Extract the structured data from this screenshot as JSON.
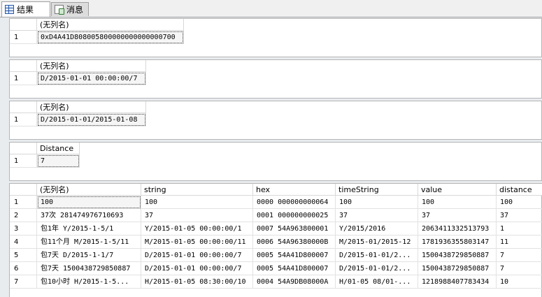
{
  "tabs": [
    {
      "label": "结果",
      "icon": "results-grid-icon",
      "active": true
    },
    {
      "label": "消息",
      "icon": "messages-icon",
      "active": false
    }
  ],
  "grids": [
    {
      "columns": [
        "(无列名)"
      ],
      "rows": [
        [
          "1",
          "0xD4A41D808005800000000000000700"
        ]
      ]
    },
    {
      "columns": [
        "(无列名)"
      ],
      "rows": [
        [
          "1",
          "D/2015-01-01 00:00:00/7"
        ]
      ]
    },
    {
      "columns": [
        "(无列名)"
      ],
      "rows": [
        [
          "1",
          "D/2015-01-01/2015-01-08"
        ]
      ]
    },
    {
      "columns": [
        "Distance"
      ],
      "rows": [
        [
          "1",
          "7"
        ]
      ]
    },
    {
      "columns": [
        "(无列名)",
        "string",
        "hex",
        "timeString",
        "value",
        "distance"
      ],
      "rows": [
        [
          "1",
          " 100",
          "100",
          "0000 000000000064",
          "100",
          "100",
          "100"
        ],
        [
          "2",
          "37次 281474976710693",
          "37",
          "0001 000000000025",
          "37",
          "37",
          "37"
        ],
        [
          "3",
          "包1年 Y/2015-1-5/1",
          "Y/2015-01-05 00:00:00/1",
          "0007 54A963800001",
          "Y/2015/2016",
          "2063411332513793",
          "1"
        ],
        [
          "4",
          "包11个月 M/2015-1-5/11",
          "M/2015-01-05 00:00:00/11",
          "0006 54A96380000B",
          "M/2015-01/2015-12",
          "1781936355803147",
          "11"
        ],
        [
          "5",
          "包7天 D/2015-1-1/7",
          "D/2015-01-01 00:00:00/7",
          "0005 54A41D800007",
          "D/2015-01-01/2...",
          "1500438729850887",
          "7"
        ],
        [
          "6",
          "包7天 1500438729850887",
          "D/2015-01-01 00:00:00/7",
          "0005 54A41D800007",
          "D/2015-01-01/2...",
          "1500438729850887",
          "7"
        ],
        [
          "7",
          "包10小时 H/2015-1-5...",
          "H/2015-01-05 08:30:00/10",
          "0004 54A9DB08000A",
          "H/01-05 08/01-...",
          "1218988407783434",
          "10"
        ]
      ]
    }
  ]
}
